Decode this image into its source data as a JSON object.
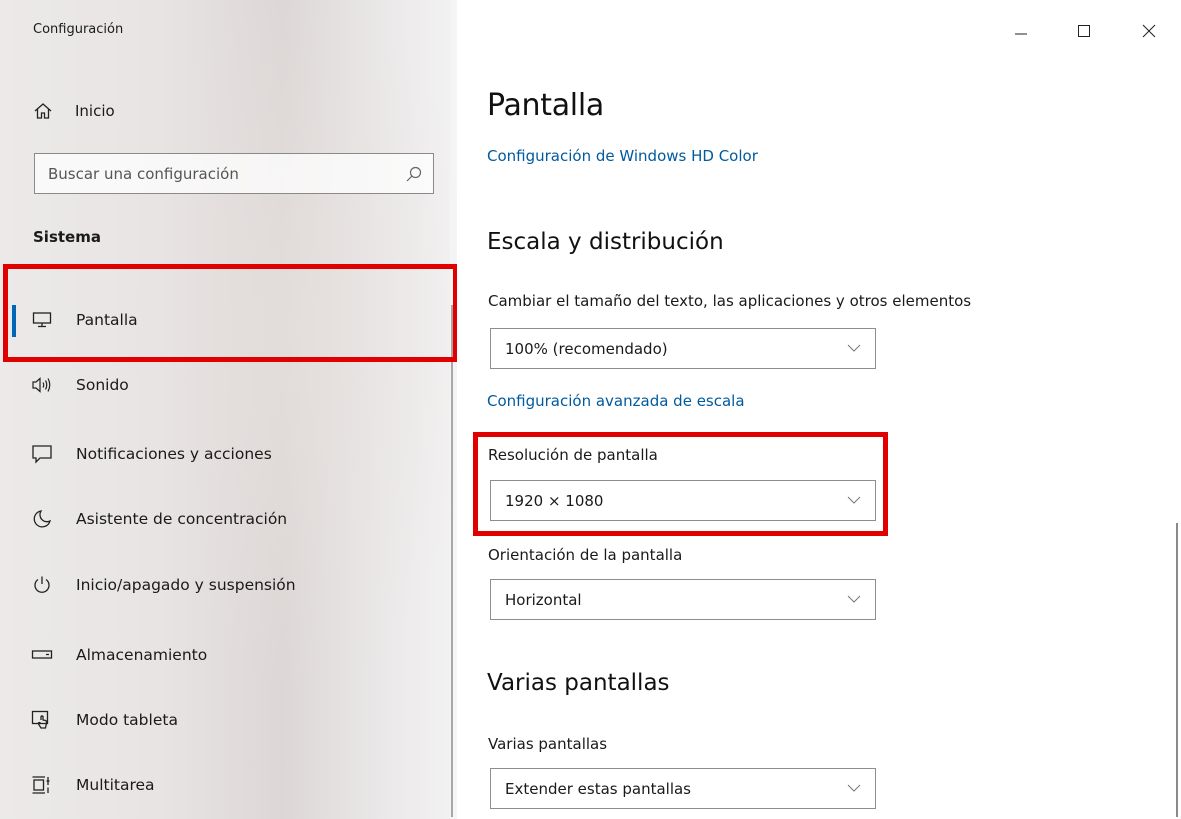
{
  "window": {
    "title": "Configuración",
    "controls": {
      "minimize": "—",
      "maximize": "☐",
      "close": "✕"
    }
  },
  "sidebar": {
    "home_label": "Inicio",
    "search_placeholder": "Buscar una configuración",
    "section_title": "Sistema",
    "items": [
      {
        "label": "Pantalla",
        "icon": "monitor-icon",
        "active": true
      },
      {
        "label": "Sonido",
        "icon": "speaker-icon"
      },
      {
        "label": "Notificaciones y acciones",
        "icon": "notification-icon"
      },
      {
        "label": "Asistente de concentración",
        "icon": "moon-icon"
      },
      {
        "label": "Inicio/apagado y suspensión",
        "icon": "power-icon"
      },
      {
        "label": "Almacenamiento",
        "icon": "storage-icon"
      },
      {
        "label": "Modo tableta",
        "icon": "tablet-mode-icon"
      },
      {
        "label": "Multitarea",
        "icon": "multitasking-icon"
      }
    ]
  },
  "main": {
    "page_title": "Pantalla",
    "hd_color_link": "Configuración de Windows HD Color",
    "scale_section": {
      "title": "Escala y distribución",
      "text_size_label": "Cambiar el tamaño del texto, las aplicaciones y otros elementos",
      "text_size_value": "100% (recomendado)",
      "advanced_link": "Configuración avanzada de escala",
      "resolution_label": "Resolución de pantalla",
      "resolution_value": "1920 × 1080",
      "orientation_label": "Orientación de la pantalla",
      "orientation_value": "Horizontal"
    },
    "multi_section": {
      "title": "Varias pantallas",
      "label": "Varias pantallas",
      "value": "Extender estas pantallas"
    }
  },
  "colors": {
    "accent": "#0067b8",
    "link": "#005a9e",
    "highlight_box": "#e10000"
  }
}
